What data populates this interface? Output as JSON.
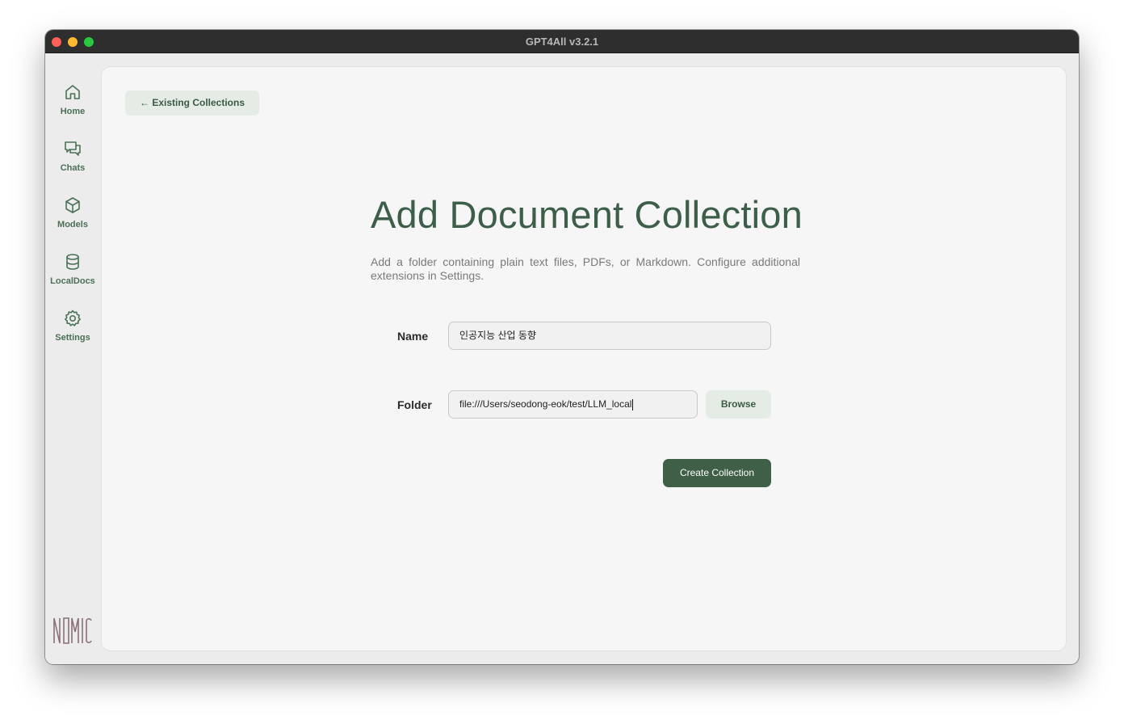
{
  "window": {
    "title": "GPT4All v3.2.1"
  },
  "sidebar": {
    "items": [
      {
        "label": "Home",
        "icon": "home-icon"
      },
      {
        "label": "Chats",
        "icon": "chats-icon"
      },
      {
        "label": "Models",
        "icon": "cube-icon"
      },
      {
        "label": "LocalDocs",
        "icon": "database-icon"
      },
      {
        "label": "Settings",
        "icon": "gear-icon"
      }
    ],
    "logo": "NOMIC"
  },
  "main": {
    "back_label": "← Existing Collections",
    "title": "Add Document Collection",
    "description": "Add a folder containing plain text files, PDFs, or Markdown. Configure additional extensions in Settings.",
    "name_label": "Name",
    "name_value": "인공지능 산업 동향",
    "folder_label": "Folder",
    "folder_value": "file:///Users/seodong-eok/test/LLM_local",
    "browse_label": "Browse",
    "create_label": "Create Collection"
  },
  "colors": {
    "accent": "#3f5f46",
    "accent_light": "#e5ece6",
    "titlebar": "#2e2e2e"
  }
}
